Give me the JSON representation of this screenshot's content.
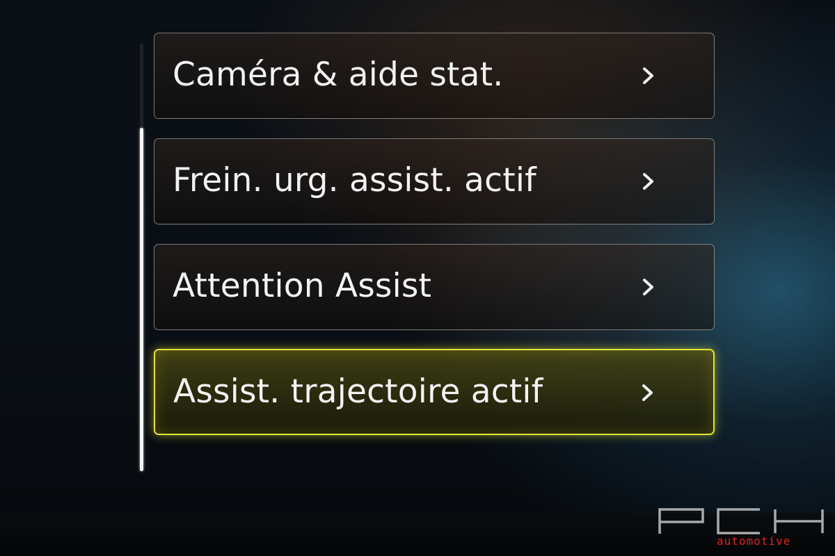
{
  "menu": {
    "items": [
      {
        "label": "Caméra & aide stat.",
        "selected": false
      },
      {
        "label": "Frein. urg. assist. actif",
        "selected": false
      },
      {
        "label": "Attention Assist",
        "selected": false
      },
      {
        "label": "Assist. trajectoire actif",
        "selected": true
      }
    ],
    "chevron_icon": "chevron-right-icon",
    "selected_color": "#e2e43a"
  },
  "watermark": {
    "brand": "PCH",
    "subtitle": "automotive",
    "subtitle_color": "#e1241f"
  }
}
